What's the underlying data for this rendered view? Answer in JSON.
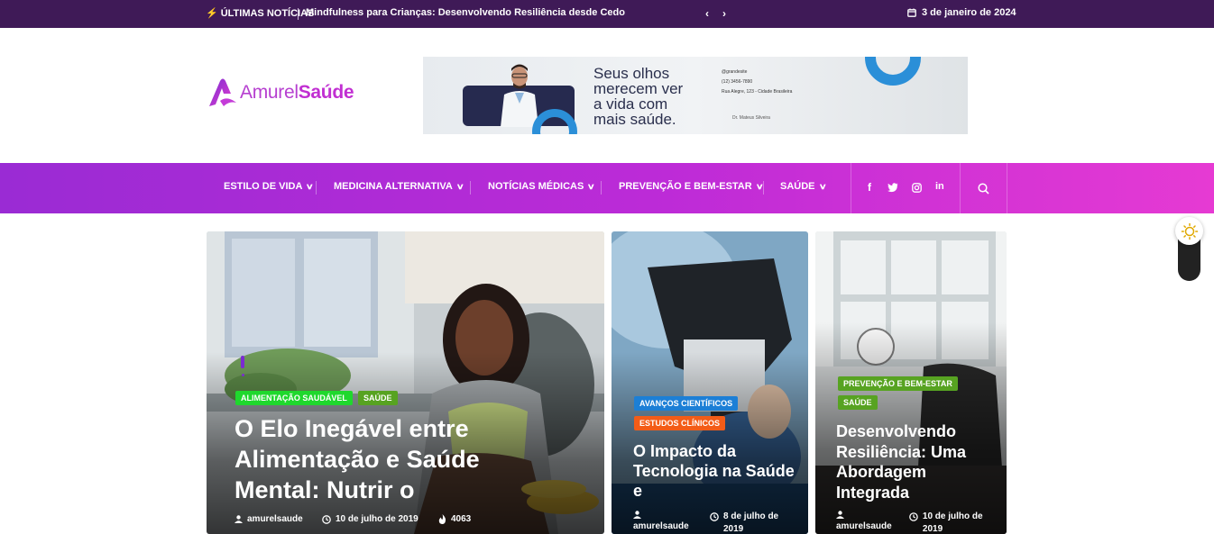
{
  "topbar": {
    "label": "ÚLTIMAS NOTÍCIAS",
    "headline": "Mindfulness para Crianças: Desenvolvendo Resiliência desde Cedo",
    "prev": "‹",
    "next": "›",
    "date": "3 de janeiro de 2024"
  },
  "logo": {
    "part1": "Amurel",
    "part2": "Saúde"
  },
  "banner": {
    "slogan": [
      "Seus olhos",
      "merecem ver",
      "a vida com",
      "mais saúde."
    ],
    "contacts": [
      "@grandesite",
      "(12) 3456-7890",
      "Rua Alegre, 123 - Cidade Brasileira"
    ],
    "signature": "Dr. Mateus Silveira"
  },
  "nav": {
    "items": [
      "ESTILO DE VIDA",
      "MEDICINA ALTERNATIVA",
      "NOTÍCIAS MÉDICAS",
      "PREVENÇÃO E BEM-ESTAR",
      "SAÚDE"
    ],
    "social": [
      "f",
      "t",
      "ig",
      "in"
    ]
  },
  "cards": [
    {
      "tags": [
        "ALIMENTAÇÃO SAUDÁVEL",
        "SAÚDE"
      ],
      "title": "O Elo Inegável entre Alimentação e Saúde Mental: Nutrir o",
      "author": "amurelsaude",
      "date": "10 de julho de 2019",
      "views": "4063"
    },
    {
      "tags": [
        "AVANÇOS CIENTÍFICOS",
        "ESTUDOS CLÍNICOS"
      ],
      "title": "O Impacto da Tecnologia na Saúde e",
      "author": "amurelsaude",
      "date": "8 de julho de 2019"
    },
    {
      "tags": [
        "PREVENÇÃO E BEM-ESTAR",
        "SAÚDE"
      ],
      "title": "Desenvolvendo Resiliência: Uma Abordagem Integrada",
      "author": "amurelsaude",
      "date": "10 de julho de 2019"
    }
  ],
  "colors": {
    "topbar": "#3f1a57",
    "tag_green": "#1fd82d",
    "tag_blue": "#1c7fd6",
    "tag_orange": "#f35c17",
    "tag_olive": "#57a321"
  }
}
